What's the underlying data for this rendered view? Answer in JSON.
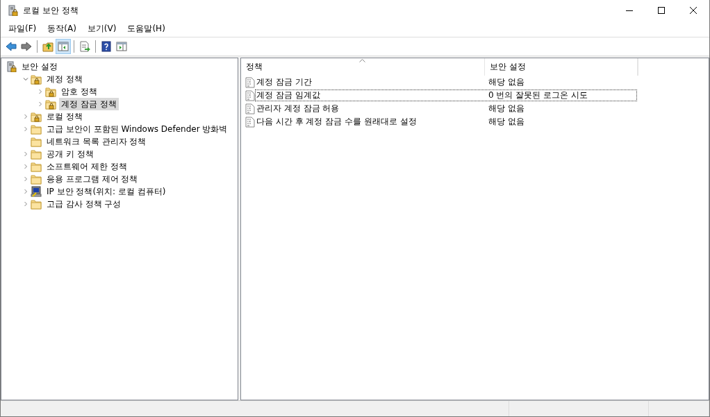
{
  "window": {
    "title": "로컬 보안 정책"
  },
  "menu": [
    "파일(F)",
    "동작(A)",
    "보기(V)",
    "도움말(H)"
  ],
  "toolbar": [
    {
      "kind": "back",
      "pressed": false
    },
    {
      "kind": "forward",
      "pressed": false
    },
    {
      "kind": "sep"
    },
    {
      "kind": "up",
      "pressed": false
    },
    {
      "kind": "tree",
      "pressed": true
    },
    {
      "kind": "sep"
    },
    {
      "kind": "export",
      "pressed": false
    },
    {
      "kind": "sep"
    },
    {
      "kind": "help",
      "pressed": false
    },
    {
      "kind": "pane",
      "pressed": false
    }
  ],
  "tree": {
    "label": "보안 설정",
    "kind": "server",
    "children": [
      {
        "label": "계정 정책",
        "kind": "lockfolder",
        "expandable": true,
        "expanded": true,
        "selected": false,
        "children": [
          {
            "label": "암호 정책",
            "kind": "lockfolder",
            "expandable": true,
            "expanded": false,
            "selected": false
          },
          {
            "label": "계정 잠금 정책",
            "kind": "lockfolder",
            "expandable": true,
            "expanded": false,
            "selected": true
          }
        ]
      },
      {
        "label": "로컬 정책",
        "kind": "lockfolder",
        "expandable": true,
        "expanded": false,
        "selected": false
      },
      {
        "label": "고급 보안이 포함된 Windows Defender 방화벽",
        "kind": "folder",
        "expandable": true,
        "expanded": false,
        "selected": false
      },
      {
        "label": "네트워크 목록 관리자 정책",
        "kind": "folder",
        "expandable": false,
        "selected": false
      },
      {
        "label": "공개 키 정책",
        "kind": "folder",
        "expandable": true,
        "expanded": false,
        "selected": false
      },
      {
        "label": "소프트웨어 제한 정책",
        "kind": "folder",
        "expandable": true,
        "expanded": false,
        "selected": false
      },
      {
        "label": "응용 프로그램 제어 정책",
        "kind": "folder",
        "expandable": true,
        "expanded": false,
        "selected": false
      },
      {
        "label": "IP 보안 정책(위치: 로컬 컴퓨터)",
        "kind": "ipsec",
        "expandable": true,
        "expanded": false,
        "selected": false
      },
      {
        "label": "고급 감사 정책 구성",
        "kind": "folder",
        "expandable": true,
        "expanded": false,
        "selected": false
      }
    ]
  },
  "table": {
    "columns": [
      "정책",
      "보안 설정"
    ],
    "rows": [
      {
        "policy": "계정 잠금 기간",
        "setting": "해당 없음",
        "focused": false
      },
      {
        "policy": "계정 잠금 임계값",
        "setting": "0 번의 잘못된 로그온 시도",
        "focused": true
      },
      {
        "policy": "관리자 계정 잠금 허용",
        "setting": "해당 없음",
        "focused": false
      },
      {
        "policy": "다음 시간 후 계정 잠금 수를 원래대로 설정",
        "setting": "해당 없음",
        "focused": false
      }
    ]
  }
}
